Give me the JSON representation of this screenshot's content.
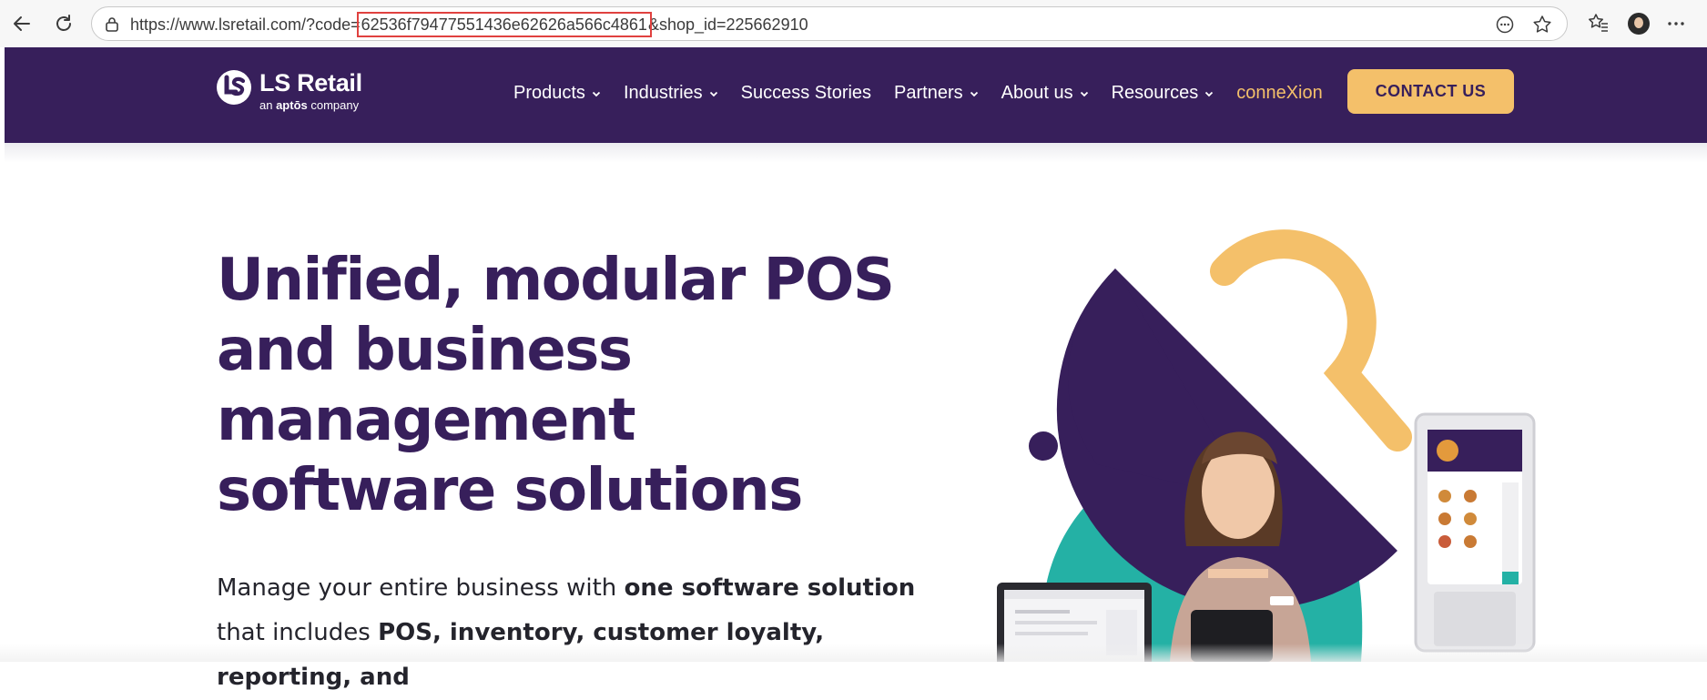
{
  "browser": {
    "url_prefix": "https://www.lsretail.com/?code=",
    "url_highlight": "62536f79477551436e62626a566c4861",
    "url_suffix": "&shop_id=225662910"
  },
  "header": {
    "logo_name": "LS Retail",
    "logo_tagline_prefix": "an ",
    "logo_tagline_brand": "aptōs",
    "logo_tagline_suffix": " company",
    "menu": [
      {
        "label": "Products"
      },
      {
        "label": "Industries"
      },
      {
        "label": "Success Stories"
      },
      {
        "label": "Partners"
      },
      {
        "label": "About us"
      },
      {
        "label": "Resources"
      },
      {
        "label": "conneXion"
      }
    ],
    "cta_label": "CONTACT US"
  },
  "hero": {
    "title": "Unified, modular POS and business management software solutions",
    "body_1": "Manage your entire business with ",
    "body_2": "one software solution",
    "body_3": " that includes ",
    "body_4": "POS, inventory, customer loyalty, reporting, and"
  },
  "colors": {
    "brand_purple": "#371f5b",
    "accent_yellow": "#f4c06a",
    "accent_teal": "#24b1a5",
    "highlight_red": "#e0413f"
  }
}
